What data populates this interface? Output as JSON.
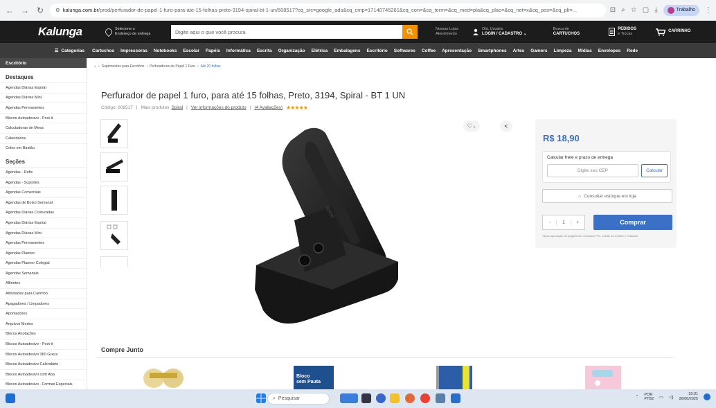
{
  "browser": {
    "url_domain": "kalunga.com.br",
    "url_path": "/prod/perfurador-de-papel-1-furo-para-ate-15-folhas-preto-3194-spiral-bt-1-un/608517?cq_src=google_ads&cq_cmp=17140745261&cq_con=&cq_term=&cq_med=pla&cq_plac=&cq_net=x&cq_pos=&cq_plt=...",
    "profile_label": "Trabalho"
  },
  "header": {
    "logo": "Kalunga",
    "location_line1": "Selecione o",
    "location_line2": "Endereço de entrega",
    "search_placeholder": "Digite aqui o que você procura",
    "stores_line1": "Nossas Lojas",
    "stores_line2": "Atendimento",
    "user_greeting": "Olá, Usuário",
    "user_login": "LOGIN / CADASTRO",
    "cartridge_line1": "Busca de",
    "cartridge_line2": "CARTUCHOS",
    "orders_line1": "PEDIDOS",
    "orders_line2": "e Trocas",
    "cart_label": "CARRINHO"
  },
  "categories": {
    "toggle_label": "Categorias",
    "items": [
      "Cartuchos",
      "Impressoras",
      "Notebooks",
      "Escolar",
      "Papéis",
      "Informática",
      "Escrita",
      "Organização",
      "Elétrica",
      "Embalagens",
      "Escritório",
      "Softwares",
      "Coffee",
      "Apresentação",
      "Smartphones",
      "Artes",
      "Gamers",
      "Limpeza",
      "Mídias",
      "Envelopes",
      "Rede"
    ]
  },
  "sidebar": {
    "header": "Escritório",
    "section_destaques": "Destaques",
    "destaques": [
      "Agendas Diárias Espiral",
      "Agendas Diárias Mini",
      "Agendas Permanentes",
      "Blocos Autoadesivo - Post-it",
      "Calculadoras de Mesa",
      "Calendários",
      "Coles em Bastão"
    ],
    "section_secoes": "Seções",
    "secoes": [
      "Agendas - Refis",
      "Agendas - Suportes",
      "Agendas Comerciais",
      "Agendas de Bolso Semanal",
      "Agendas Diárias Costuradas",
      "Agendas Diárias Espiral",
      "Agendas Diárias Mini",
      "Agendas Permanentes",
      "Agendas Planner",
      "Agendas Planner Colegial",
      "Agendas Semanais",
      "Alfinetes",
      "Almofadas para Carimbo",
      "Apagadores / Limpadores",
      "Apontadores",
      "Arquivos Mortos",
      "Blocos Anotações",
      "Blocos Autoadesivo - Post-it",
      "Blocos Autoadesivo 360 Graus",
      "Blocos Autoadesivo Calendário",
      "Blocos Autoadesivo com Aba",
      "Blocos Autoadesivo - Formas Especiais"
    ]
  },
  "breadcrumb": {
    "items": [
      "Suprimentos para Escritório",
      "Perfuradores de Papel 1 Furo"
    ],
    "current": "Até 20 folhas"
  },
  "product": {
    "title": "Perfurador de papel 1 furo, para até 15 folhas, Preto, 3194, Spiral - BT 1 UN",
    "code": "Código: 608517",
    "more_products_prefix": "Mais produtos",
    "brand": "Spiral",
    "info_link": "Ver informações do produto",
    "reviews": "(4 Avaliações)",
    "rating_stars": 5,
    "image_brand_mark": "spiral"
  },
  "buy_box": {
    "price": "R$ 18,90",
    "frete_title": "Calcular frete e prazo de entrega",
    "cep_placeholder": "Digite seu CEP",
    "calc_button": "Calcular",
    "estoque_button": "Consultar estoque em loja",
    "qty_minus": "-",
    "qty_value": "1",
    "qty_plus": "+",
    "buy_button": "Comprar",
    "fine_print": "*Após aprovação do pagamento. Exclusivo PIX, Cartão de Crédito e Faturado"
  },
  "compre_junto": {
    "title": "Compre Junto",
    "item2_text_line1": "Bloco",
    "item2_text_line2": "sem Pauta"
  },
  "taskbar": {
    "search_label": "Pesquisar",
    "lang_line1": "POR",
    "lang_line2": "PTB2",
    "time": "19:31",
    "date": "26/06/2025"
  },
  "colors": {
    "accent": "#3a70c6",
    "orange": "#f39200",
    "header_bg": "#1c1c1c",
    "nav_bg": "#3b3b3b"
  }
}
